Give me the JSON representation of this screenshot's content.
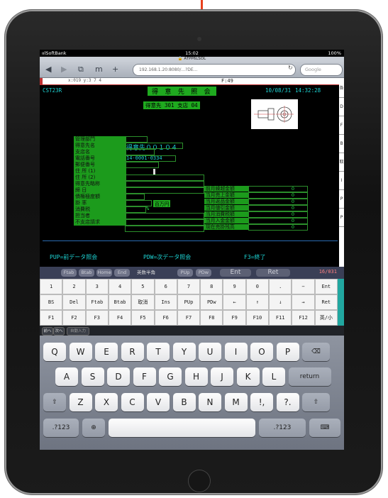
{
  "status": {
    "carrier": "ıılSoftBank",
    "time": "15:02",
    "battery": "100%"
  },
  "browser": {
    "page_title": "ATPP6LSOL",
    "url": "192.168.1.20:8080/...?DE...",
    "search_placeholder": "Google",
    "back": "◀",
    "forward": "▶",
    "tabs": "⧉",
    "bookmarks": "m"
  },
  "term": {
    "ruler": "x:019          y:3 7 4",
    "topfield": "F:49",
    "code": "CST23R",
    "title": "得 意 先 照 会",
    "date": "10/08/31",
    "time": "14:32:28",
    "sub": "得意先 301  支店 04",
    "labels": [
      "管理部門",
      "得意先名",
      "支店名",
      "電話番号",
      "郵便番号",
      "住  所 (1)",
      "住  所 (2)",
      "得意先略称",
      "締   日",
      "債権極度額",
      "掛    率",
      "消費税",
      "担当者",
      "不支店請求"
    ],
    "cust_name": "得意先００１０４",
    "phone": "14-0001-0334",
    "limit_unit": "百万円",
    "percent": "%",
    "right_labels": [
      "前月繰越金額",
      "当月売上金額",
      "当月返品金額",
      "当月値引金額",
      "当月消費税額",
      "当月入金金額",
      "現在売掛残高"
    ],
    "right_values": [
      "0",
      "0",
      "0",
      "0",
      "0",
      "0",
      "0"
    ],
    "func1": "PUP=前データ照会",
    "func2": "PDW=次データ照会",
    "func3": "F3=終了",
    "right_buttons": [
      "各",
      "D",
      "F",
      "B",
      "取",
      "I",
      "P",
      "P"
    ]
  },
  "fkeys": [
    "Ftab",
    "Btab",
    "Home",
    "End",
    "英数半角",
    "PUp",
    "PDw",
    "Ent",
    "Ret"
  ],
  "fkey_status": "16/031",
  "grid": [
    [
      "1",
      "2",
      "3",
      "4",
      "5",
      "6",
      "7",
      "8",
      "9",
      "0",
      ".",
      "−",
      "Ent"
    ],
    [
      "BS",
      "Del",
      "Ftab",
      "Btab",
      "取消",
      "Ins",
      "PUp",
      "PDw",
      "←",
      "↑",
      "↓",
      "→",
      "Ret"
    ],
    [
      "F1",
      "F2",
      "F3",
      "F4",
      "F5",
      "F6",
      "F7",
      "F8",
      "F9",
      "F10",
      "F11",
      "F12",
      "英/小"
    ]
  ],
  "kbtools": {
    "prev": "前へ",
    "next": "次へ",
    "autofill": "自動入力"
  },
  "keyboard": {
    "row1": [
      "Q",
      "W",
      "E",
      "R",
      "T",
      "Y",
      "U",
      "I",
      "O",
      "P"
    ],
    "row2": [
      "A",
      "S",
      "D",
      "F",
      "G",
      "H",
      "J",
      "K",
      "L"
    ],
    "row3": [
      "Z",
      "X",
      "C",
      "V",
      "B",
      "N",
      "M",
      "!,",
      "?."
    ],
    "return": "return",
    "num": ".?123",
    "delete": "⌫",
    "shift": "⇧",
    "globe": "⊕",
    "hide": "⌨"
  }
}
